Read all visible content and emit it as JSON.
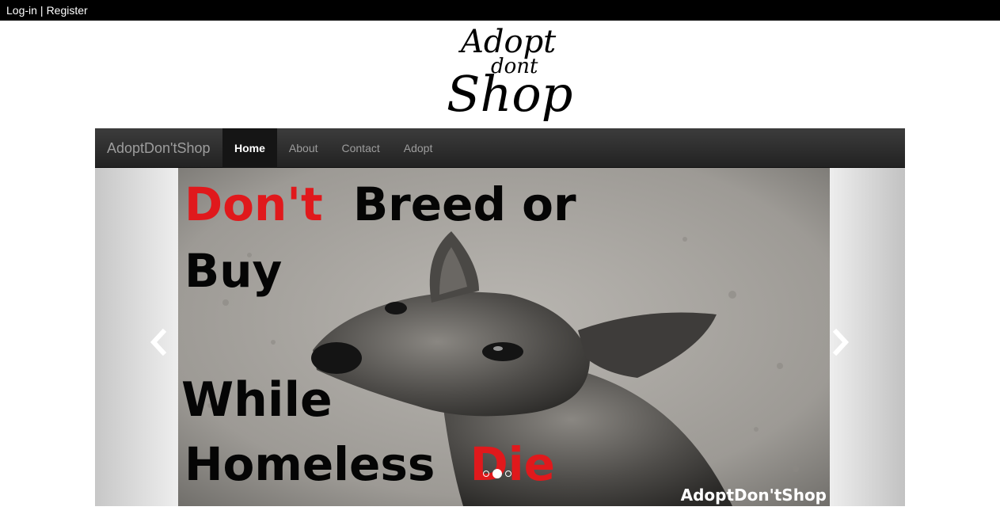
{
  "topbar": {
    "login": "Log-in",
    "separator": "|",
    "register": "Register"
  },
  "logo": {
    "line1": "Adopt",
    "line2": "dont",
    "line3": "Shop"
  },
  "navbar": {
    "brand": "AdoptDon'tShop",
    "items": [
      {
        "label": "Home",
        "active": true
      },
      {
        "label": "About",
        "active": false
      },
      {
        "label": "Contact",
        "active": false
      },
      {
        "label": "Adopt",
        "active": false
      }
    ]
  },
  "carousel": {
    "slide": {
      "word_dont": "Don't",
      "word_breed_or": "Breed or",
      "word_buy": "Buy",
      "word_while": "While",
      "word_homeless": "Homeless",
      "word_die": "Die",
      "watermark": "AdoptDon'tShop"
    },
    "indicator_count": 3,
    "active_index": 1,
    "colors": {
      "red_text": "#e0191c",
      "black_text": "#050505"
    }
  },
  "icons": {
    "prev": "chevron-left-icon",
    "next": "chevron-right-icon"
  }
}
